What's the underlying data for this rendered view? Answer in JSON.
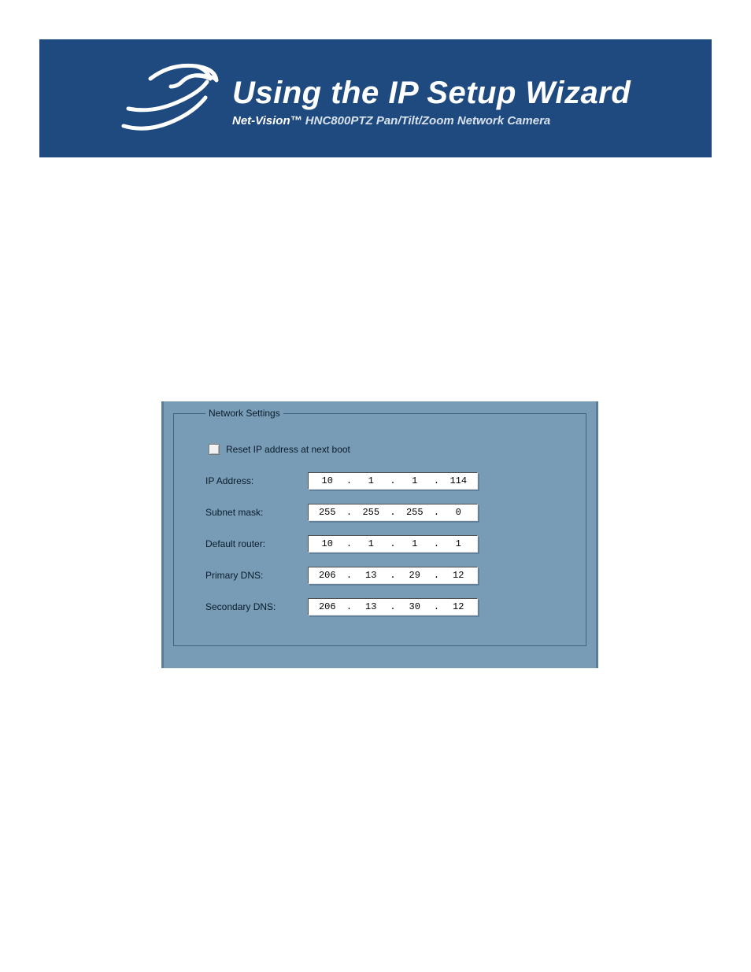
{
  "banner": {
    "title": "Using the IP Setup Wizard",
    "brand": "Net-Vision™",
    "product": "HNC800PTZ Pan/Tilt/Zoom Network Camera"
  },
  "panel": {
    "legend": "Network Settings",
    "reset_label": "Reset IP address at next boot",
    "reset_checked": false,
    "rows": [
      {
        "label": "IP Address:",
        "o1": "10",
        "o2": "1",
        "o3": "1",
        "o4": "114"
      },
      {
        "label": "Subnet mask:",
        "o1": "255",
        "o2": "255",
        "o3": "255",
        "o4": "0"
      },
      {
        "label": "Default router:",
        "o1": "10",
        "o2": "1",
        "o3": "1",
        "o4": "1"
      },
      {
        "label": "Primary DNS:",
        "o1": "206",
        "o2": "13",
        "o3": "29",
        "o4": "12"
      },
      {
        "label": "Secondary DNS:",
        "o1": "206",
        "o2": "13",
        "o3": "30",
        "o4": "12"
      }
    ]
  }
}
